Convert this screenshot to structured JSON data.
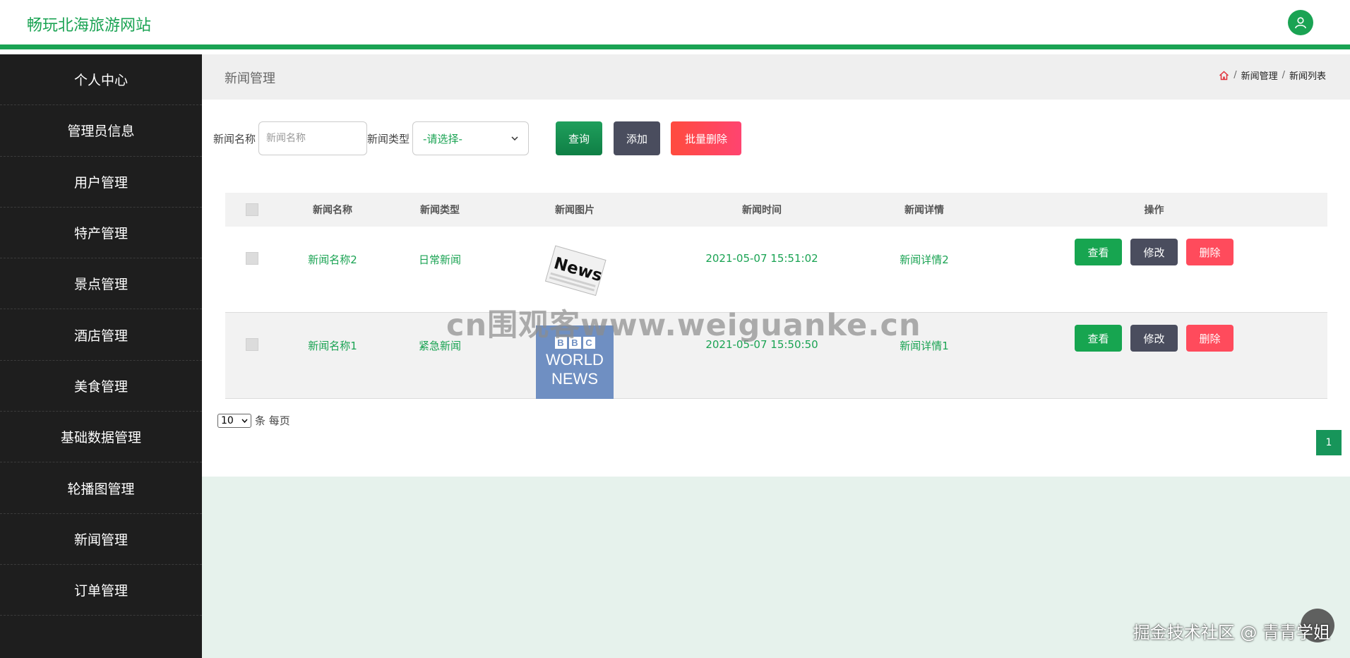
{
  "header": {
    "site_title": "畅玩北海旅游网站",
    "avatar_icon": "user-icon"
  },
  "sidebar": {
    "items": [
      {
        "label": "个人中心"
      },
      {
        "label": "管理员信息"
      },
      {
        "label": "用户管理"
      },
      {
        "label": "特产管理"
      },
      {
        "label": "景点管理"
      },
      {
        "label": "酒店管理"
      },
      {
        "label": "美食管理"
      },
      {
        "label": "基础数据管理"
      },
      {
        "label": "轮播图管理"
      },
      {
        "label": "新闻管理"
      },
      {
        "label": "订单管理"
      }
    ]
  },
  "page": {
    "title": "新闻管理",
    "breadcrumb": {
      "home_icon": "home-icon",
      "separator": "/",
      "level1": "新闻管理",
      "level2": "新闻列表"
    }
  },
  "search": {
    "name_label": "新闻名称",
    "name_placeholder": "新闻名称",
    "type_label": "新闻类型",
    "type_selected": "-请选择-",
    "query_label": "查询",
    "add_label": "添加",
    "batch_delete_label": "批量删除"
  },
  "table": {
    "headers": {
      "name": "新闻名称",
      "type": "新闻类型",
      "image": "新闻图片",
      "time": "新闻时间",
      "detail": "新闻详情",
      "op": "操作"
    },
    "rows": [
      {
        "name": "新闻名称2",
        "type": "日常新闻",
        "image": "News",
        "time": "2021-05-07 15:51:02",
        "detail": "新闻详情2",
        "view": "查看",
        "edit": "修改",
        "delete": "删除"
      },
      {
        "name": "新闻名称1",
        "type": "紧急新闻",
        "image_top": "BBC",
        "image_mid": "WORLD",
        "image_bot": "NEWS",
        "time": "2021-05-07 15:50:50",
        "detail": "新闻详情1",
        "view": "查看",
        "edit": "修改",
        "delete": "删除"
      }
    ]
  },
  "pagination": {
    "page_size": "10",
    "page_size_suffix": "条 每页",
    "current_page": "1"
  },
  "watermark": {
    "center": "cn围观客www.weiguanke.cn",
    "corner": "掘金技术社区 @ 青青学姐"
  },
  "colors": {
    "primary": "#1aa353",
    "sidebar_bg": "#1e1e1e",
    "danger": "#ff4b5c",
    "dark_button": "#4a4d5e"
  }
}
